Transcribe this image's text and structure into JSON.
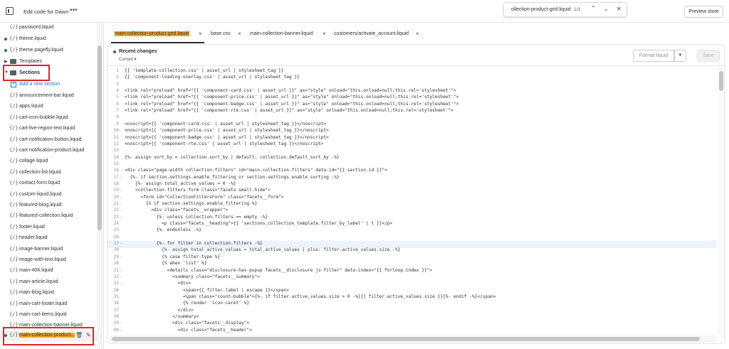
{
  "topbar": {
    "title": "Edit code for Dawn",
    "more_icon": "•••",
    "search": {
      "query": "ollection-product-grid.liquid",
      "count": "1/3"
    },
    "preview_label": "Preview store"
  },
  "sidebar": {
    "items": [
      {
        "label": "password.liquid",
        "dot": false
      },
      {
        "label": "theme.liquid",
        "dot": true
      },
      {
        "label": "theme.pagefly.liquid",
        "dot": true
      }
    ],
    "templates_label": "Templates",
    "sections_label": "Sections",
    "add_section_label": "Add a new section",
    "section_files": [
      "announcement-bar.liquid",
      "apps.liquid",
      "cart-icon-bubble.liquid",
      "cart-live-region-text.liquid",
      "cart-notification-button.liquid",
      "cart-notification-product.liquid",
      "collage.liquid",
      "collection-list.liquid",
      "contact-form.liquid",
      "custom-liquid.liquid",
      "featured-blog.liquid",
      "featured-collection.liquid",
      "footer.liquid",
      "header.liquid",
      "image-banner.liquid",
      "image-with-text.liquid",
      "main-404.liquid",
      "main-article.liquid",
      "main-blog.liquid",
      "main-cart-footer.liquid",
      "main-cart-items.liquid",
      "main-collection-banner.liquid"
    ],
    "selected_file": "main-collection-product..."
  },
  "tabs": [
    {
      "label": "main-collection-product-grid.liquid",
      "active": true
    },
    {
      "label": "base.css",
      "active": false
    },
    {
      "label": "main-collection-banner.liquid",
      "active": false
    },
    {
      "label": "customers/activate_account.liquid",
      "active": false
    }
  ],
  "editor": {
    "recent_title": "Recent changes",
    "recent_sub": "Current ▾",
    "format_label": "Format liquid",
    "save_label": "Save",
    "lines": [
      {
        "n": "1",
        "t": "{{ 'template-collection.css' | asset_url | stylesheet_tag }}"
      },
      {
        "n": "2",
        "t": "{{ 'component-loading-overlay.css' | asset_url | stylesheet_tag }}"
      },
      {
        "n": "3",
        "t": ""
      },
      {
        "n": "4",
        "t": "<link rel=\"preload\" href=\"{{ 'component-card.css' | asset_url }}\" as=\"style\" onload=\"this.onload=null;this.rel='stylesheet'\">"
      },
      {
        "n": "5",
        "t": "<link rel=\"preload\" href=\"{{ 'component-price.css' | asset_url }}\" as=\"style\" onload=\"this.onload=null;this.rel='stylesheet'\">"
      },
      {
        "n": "6",
        "t": "<link rel=\"preload\" href=\"{{ 'component-badge.css' | asset_url }}\" as=\"style\" onload=\"this.onload=null;this.rel='stylesheet'\">"
      },
      {
        "n": "7",
        "t": "<link rel=\"preload\" href=\"{{ 'component-rte.css' | asset_url }}\" as=\"style\" onload=\"this.onload=null;this.rel='stylesheet'\">"
      },
      {
        "n": "8",
        "t": ""
      },
      {
        "n": "9",
        "t": "<noscript>{{ 'component-card.css' | asset_url | stylesheet_tag }}</noscript>"
      },
      {
        "n": "10",
        "t": "<noscript>{{ 'component-price.css' | asset_url | stylesheet_tag }}</noscript>"
      },
      {
        "n": "11",
        "t": "<noscript>{{ 'component-badge.css' | asset_url | stylesheet_tag }}</noscript>"
      },
      {
        "n": "12",
        "t": "<noscript>{{ 'component-rte.css' | asset_url | stylesheet_tag }}</noscript>"
      },
      {
        "n": "13",
        "t": ""
      },
      {
        "n": "14",
        "t": "{%- assign sort_by = collection.sort_by | default: collection.default_sort_by -%}"
      },
      {
        "n": "15",
        "t": ""
      },
      {
        "n": "16",
        "t": "<div class=\"page-width collection-filters\" id=\"main-collection-filters\" data-id=\"{{ section.id }}\">",
        "fold": true
      },
      {
        "n": "17",
        "t": "  {%- if section.settings.enable_filtering or section.settings.enable_sorting -%}",
        "fold": true
      },
      {
        "n": "18",
        "t": "    {%- assign total_active_values = 0 -%}"
      },
      {
        "n": "19",
        "t": "    <collection-filters-form class=\"facets small-hide\">",
        "fold": true
      },
      {
        "n": "20",
        "t": "      <form id=\"CollectionFiltersForm\" class=\"facets__form\">",
        "fold": true
      },
      {
        "n": "21",
        "t": "        {% if section.settings.enable_filtering %}",
        "fold": true
      },
      {
        "n": "22",
        "t": "          <div class=\"facets__wrapper\">",
        "fold": true
      },
      {
        "n": "23",
        "t": "            {%- unless collection.filters == empty -%}",
        "fold": true
      },
      {
        "n": "24",
        "t": "              <p class=\"facets__heading\">{{ 'sections.collection_template.filter_by_label' | t }}</p>"
      },
      {
        "n": "25",
        "t": "            {%- endunless -%}"
      },
      {
        "n": "26",
        "t": ""
      },
      {
        "n": "27",
        "t": "            {%- for filter in collection.filters -%}",
        "fold": true,
        "current": true
      },
      {
        "n": "28",
        "t": "              {%- assign total_active_values = total_active_values | plus: filter.active_values.size -%}"
      },
      {
        "n": "29",
        "t": "              {% case filter.type %}",
        "fold": true
      },
      {
        "n": "30",
        "t": "              {% when 'list' %}"
      },
      {
        "n": "31",
        "t": "                <details class=\"disclosure-has-popup facets__disclosure js-filter\" data-index=\"{{ forloop.index }}\">",
        "fold": true
      },
      {
        "n": "32",
        "t": "                  <summary class=\"facets__summary\">",
        "fold": true
      },
      {
        "n": "33",
        "t": "                    <div>",
        "fold": true
      },
      {
        "n": "34",
        "t": "                      <span>{{ filter.label | escape }}</span>"
      },
      {
        "n": "35",
        "t": "                      <span class=\"count-bubble\">{%- if filter.active_values.size > 0 -%}{{ filter.active_values.size }}{%- endif -%}</span>"
      },
      {
        "n": "36",
        "t": "                      {% render 'icon-caret' %}"
      },
      {
        "n": "37",
        "t": "                    </div>"
      },
      {
        "n": "38",
        "t": "                  </summary>"
      },
      {
        "n": "39",
        "t": "                  <div class=\"facets__display\">",
        "fold": true
      },
      {
        "n": "40",
        "t": "                    <div class=\"facets__header\">",
        "fold": true
      }
    ]
  },
  "colors": {
    "highlight": "#f6a623",
    "annotation_red": "#e02424",
    "modified_dot": "#1f7a4d",
    "link_blue": "#2c6ecb"
  },
  "icons": [
    "exit-icon",
    "more-icon",
    "chevron-up-icon",
    "chevron-down-icon",
    "close-icon",
    "file-liquid-icon",
    "folder-icon",
    "chevron-right-icon",
    "add-icon",
    "trash-icon",
    "pencil-icon",
    "caret-down-icon"
  ]
}
